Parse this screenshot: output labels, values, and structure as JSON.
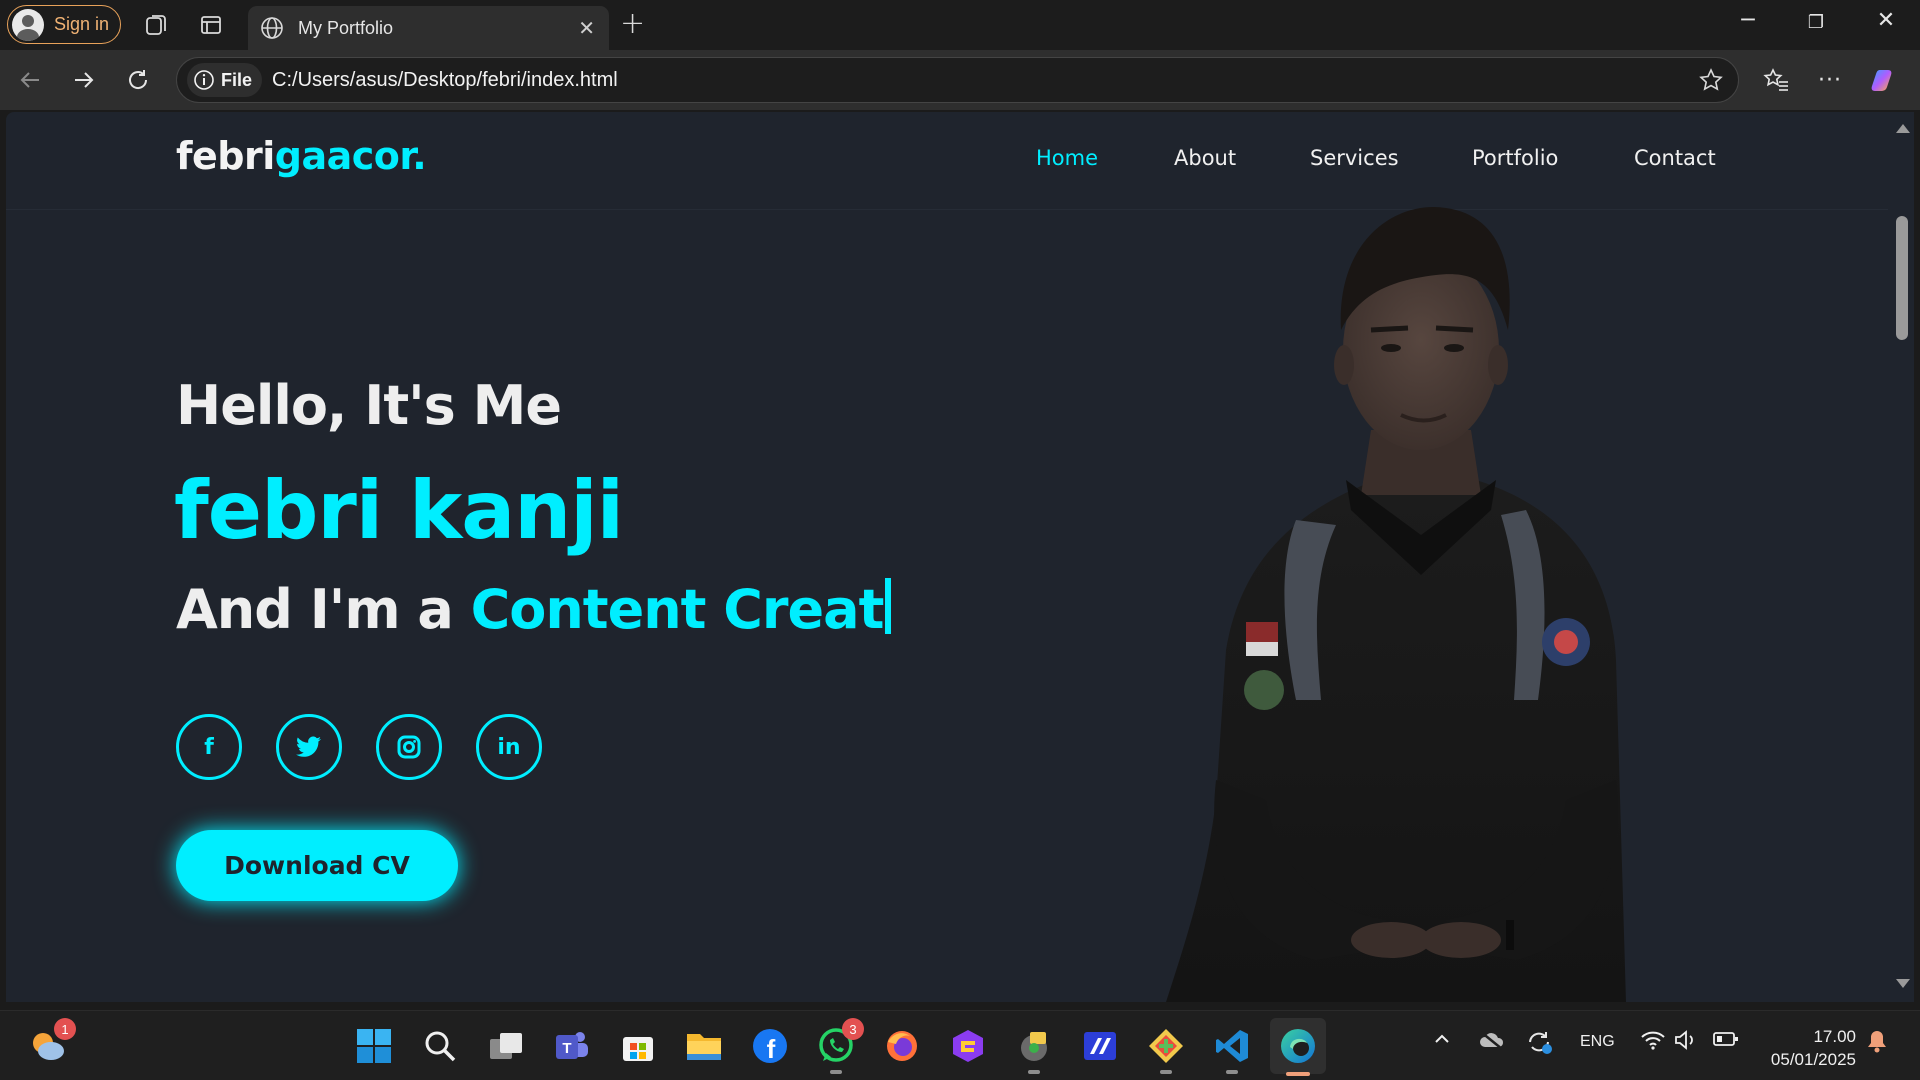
{
  "browser": {
    "signin_label": "Sign in",
    "tab_title": "My Portfolio",
    "url_prefix": "File",
    "url": "C:/Users/asus/Desktop/febri/index.html"
  },
  "site": {
    "logo_main": "febri",
    "logo_accent": "gaacor.",
    "nav": [
      {
        "label": "Home",
        "active": true
      },
      {
        "label": "About",
        "active": false
      },
      {
        "label": "Services",
        "active": false
      },
      {
        "label": "Portfolio",
        "active": false
      },
      {
        "label": "Contact",
        "active": false
      }
    ],
    "greeting": "Hello, It's Me",
    "name": "febri kanji",
    "role_prefix": "And I'm a ",
    "role": "Content Creat",
    "socials": [
      {
        "icon": "facebook-icon",
        "glyph": "f"
      },
      {
        "icon": "twitter-icon",
        "glyph": ""
      },
      {
        "icon": "instagram-icon",
        "glyph": ""
      },
      {
        "icon": "linkedin-icon",
        "glyph": "in"
      }
    ],
    "cta_label": "Download CV",
    "accent_color": "#00eeff",
    "bg_color": "#1f242d"
  },
  "taskbar": {
    "weather_badge": "1",
    "whatsapp_badge": "3",
    "language": "ENG",
    "time": "17.00",
    "date": "05/01/2025"
  }
}
